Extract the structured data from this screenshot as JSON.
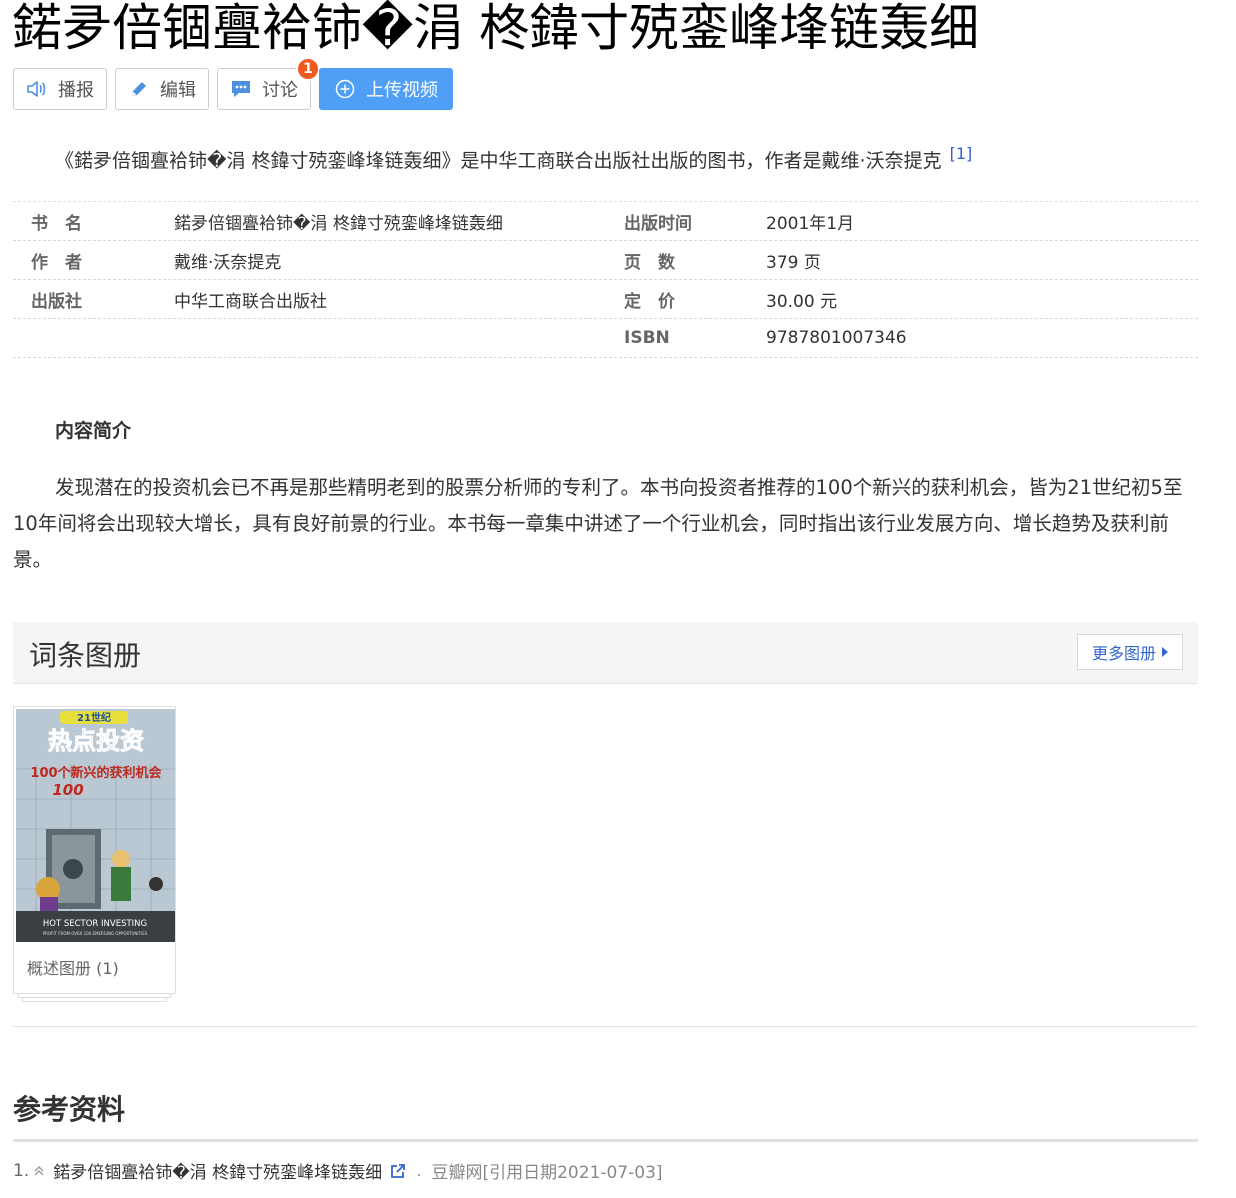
{
  "page": {
    "title": "鍩夛倍锢亹袷铈�涓  柊鍏寸殑銮峰埄链轰细"
  },
  "toolbar": {
    "read_label": "播报",
    "edit_label": "编辑",
    "discuss_label": "讨论",
    "discuss_badge": "1",
    "upload_label": "上传视频",
    "accent_color": "#4e9ff5",
    "badge_color": "#f05a22"
  },
  "summary": {
    "text": "《鍩夛倍锢亹袷铈�涓  柊鍏寸殑銮峰埄链轰细》是中华工商联合出版社出版的图书，作者是戴维·沃奈提克",
    "ref": "[1]"
  },
  "info": {
    "rows": [
      {
        "k1": "书　名",
        "v1": "鍩夛倍锢亹袷铈�涓  柊鍏寸殑銮峰埄链轰细",
        "k2": "出版时间",
        "v2": "2001年1月"
      },
      {
        "k1": "作　者",
        "v1": "戴维·沃奈提克",
        "k2": "页　数",
        "v2": "379 页"
      },
      {
        "k1": "出版社",
        "v1": "中华工商联合出版社",
        "k2": "定　价",
        "v2": "30.00 元"
      },
      {
        "k1": "",
        "v1": "",
        "k2": "ISBN",
        "v2": "9787801007346"
      }
    ]
  },
  "content": {
    "heading": "内容简介",
    "paragraph": "发现潜在的投资机会已不再是那些精明老到的股票分析师的专利了。本书向投资者推荐的100个新兴的获利机会，皆为21世纪初5至10年间将会出现较大增长，具有良好前景的行业。本书每一章集中讲述了一个行业机会，同时指出该行业发展方向、增长趋势及获利前景。"
  },
  "album": {
    "title": "词条图册",
    "more_label": "更多图册",
    "card_caption": "概述图册 (1)",
    "cover": {
      "top_label": "21世纪",
      "main_title": "热点投资",
      "subtitle": "100个新兴的获利机会",
      "big_num": "100",
      "en_title": "HOT SECTOR INVESTING",
      "en_sub": "PROFIT FROM OVER 100 EMERGING OPPORTUNITIES"
    }
  },
  "references": {
    "title": "参考资料",
    "items": [
      {
        "num": "1.",
        "text": "鍩夛倍锢亹袷铈�涓  柊鍏寸殑銮峰埄链轰细",
        "dot": ".",
        "source": "豆瓣网[引用日期2021-07-03]"
      }
    ]
  }
}
